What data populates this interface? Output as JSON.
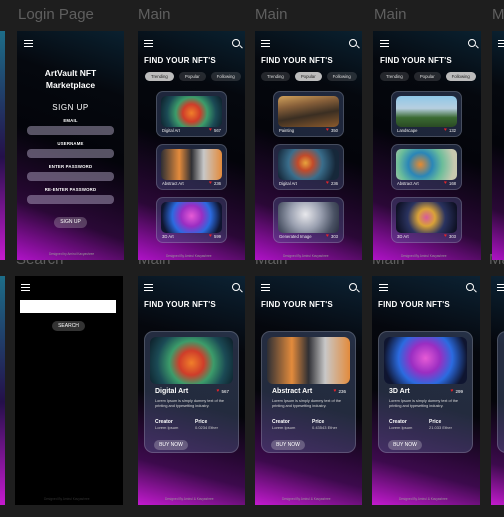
{
  "labels": {
    "login": "Login Page",
    "main": "Main",
    "search": "Search"
  },
  "common": {
    "find_title": "FIND YOUR NFT'S",
    "tabs": [
      "Trending",
      "Popular",
      "Following"
    ],
    "footer": "Designed By Amirul Kavyashree"
  },
  "login": {
    "title_line1": "ArtVault NFT",
    "title_line2": "Marketplace",
    "heading": "SIGN UP",
    "fields": [
      "EMAIL",
      "USERNAME",
      "ENTER PASSWORD",
      "RE-ENTER PASSWORD"
    ],
    "button": "SIGN UP",
    "footer": "Designed by Amirul Kavyashree"
  },
  "main1": {
    "cards": [
      {
        "name": "Digital Art",
        "likes": "567"
      },
      {
        "name": "Abstract Art",
        "likes": "236"
      },
      {
        "name": "3D Art",
        "likes": "599"
      }
    ]
  },
  "main2": {
    "cards": [
      {
        "name": "Painting",
        "likes": "350"
      },
      {
        "name": "Digital Art",
        "likes": "236"
      },
      {
        "name": "Generated Image",
        "likes": "303"
      }
    ]
  },
  "main3": {
    "cards": [
      {
        "name": "Landscape",
        "likes": "132"
      },
      {
        "name": "Abstract Art",
        "likes": "168"
      },
      {
        "name": "3D Art",
        "likes": "303"
      }
    ]
  },
  "search": {
    "button": "SEARCH",
    "footer": "Designed By Amirul Kavyashree"
  },
  "details": [
    {
      "name": "Digital Art",
      "likes": "567",
      "desc": "Lorem Ipsum is simply dummy text of the printing and typesetting industry.",
      "creator_label": "Creator",
      "creator": "Lorem Ipsum",
      "price_label": "Price",
      "price": "0.0234 Ether",
      "button": "BUY NOW"
    },
    {
      "name": "Abstract Art",
      "likes": "236",
      "desc": "Lorem Ipsum is simply dummy text of the printing and typesetting industry.",
      "creator_label": "Creator",
      "creator": "Lorem Ipsum",
      "price_label": "Price",
      "price": "0.43543 Ether",
      "button": "BUY NOW"
    },
    {
      "name": "3D Art",
      "likes": "299",
      "desc": "Lorem Ipsum is simply dummy text of the printing and typesetting industry.",
      "creator_label": "Creator",
      "creator": "Lorem Ipsum",
      "price_label": "Price",
      "price": "21.033 Ether",
      "button": "BUY NOW"
    }
  ],
  "detail_footer": "Designed By Amirul & Kavyashree"
}
